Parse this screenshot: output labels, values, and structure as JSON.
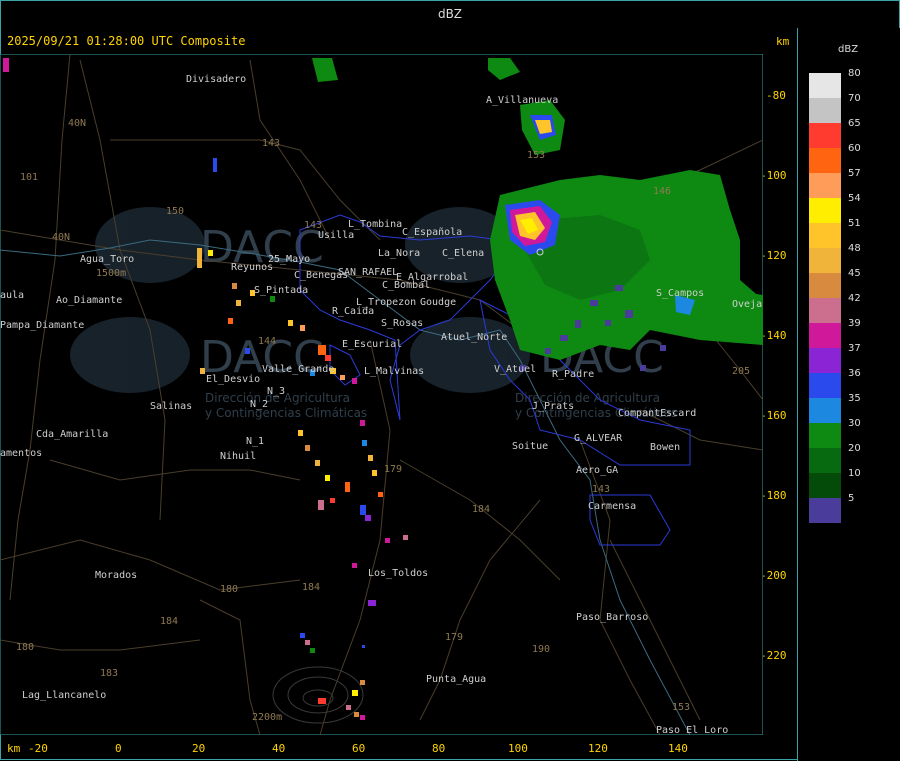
{
  "top_title": "dBZ",
  "header": {
    "timestamp": "2025/09/21 01:28:00 UTC Composite",
    "units_top": "km",
    "units_bottom": "km"
  },
  "x_axis": {
    "ticks": [
      "-20",
      "0",
      "20",
      "40",
      "60",
      "80",
      "100",
      "120",
      "140"
    ]
  },
  "y_axis": {
    "ticks": [
      "-80",
      "-100",
      "-120",
      "-140",
      "-160",
      "-180",
      "-200",
      "-220"
    ]
  },
  "legend": {
    "title": "dBZ",
    "entries": [
      {
        "label": "80",
        "color": "#e6e6e6"
      },
      {
        "label": "70",
        "color": "#c4c4c4"
      },
      {
        "label": "65",
        "color": "#ff3a2e"
      },
      {
        "label": "60",
        "color": "#ff6410"
      },
      {
        "label": "57",
        "color": "#ff9c5a"
      },
      {
        "label": "54",
        "color": "#ffee00"
      },
      {
        "label": "51",
        "color": "#ffc42a"
      },
      {
        "label": "48",
        "color": "#f0b43a"
      },
      {
        "label": "45",
        "color": "#d88a3e"
      },
      {
        "label": "42",
        "color": "#cc6e8e"
      },
      {
        "label": "39",
        "color": "#d0189a"
      },
      {
        "label": "37",
        "color": "#8a24d4"
      },
      {
        "label": "36",
        "color": "#2a4aee"
      },
      {
        "label": "35",
        "color": "#1c88e0"
      },
      {
        "label": "30",
        "color": "#0e8a12"
      },
      {
        "label": "20",
        "color": "#086a10"
      },
      {
        "label": "10",
        "color": "#044a08"
      },
      {
        "label": "5",
        "color": "#4a3c9a"
      }
    ]
  },
  "watermark": {
    "brand": "DACC",
    "line1": "Dirección de Agricultura",
    "line2": "y Contingencias Climáticas"
  },
  "places": [
    {
      "id": "divisadero",
      "name": "Divisadero"
    },
    {
      "id": "a-villanueva",
      "name": "A_Villanueva"
    },
    {
      "id": "agua-toro",
      "name": "Agua_Toro"
    },
    {
      "id": "reyunos",
      "name": "Reyunos"
    },
    {
      "id": "25-mayo",
      "name": "25_Mayo"
    },
    {
      "id": "s-pintada",
      "name": "S_Pintada"
    },
    {
      "id": "usilla",
      "name": "Usilla"
    },
    {
      "id": "l-tombina",
      "name": "L_Tombina"
    },
    {
      "id": "c-espanola",
      "name": "C_Española"
    },
    {
      "id": "la-nora",
      "name": "La_Nora"
    },
    {
      "id": "c-benegas",
      "name": "C_Benegas"
    },
    {
      "id": "san-rafael",
      "name": "SAN_RAFAEL"
    },
    {
      "id": "e-algarrobal",
      "name": "E_Algarrobal"
    },
    {
      "id": "c-bombal",
      "name": "C_Bombal"
    },
    {
      "id": "c-elena",
      "name": "C_Elena"
    },
    {
      "id": "tropezon",
      "name": "L_Tropezon"
    },
    {
      "id": "gouge",
      "name": "Goudge"
    },
    {
      "id": "r-caida",
      "name": "R_Caida"
    },
    {
      "id": "s-rosas",
      "name": "S_Rosas"
    },
    {
      "id": "atuel-norte",
      "name": "Atuel_Norte"
    },
    {
      "id": "e-escurial",
      "name": "E_Escurial"
    },
    {
      "id": "valle-grande",
      "name": "Valle_Grande"
    },
    {
      "id": "l-malvinas",
      "name": "L_Malvinas"
    },
    {
      "id": "el-desvio",
      "name": "El_Desvio"
    },
    {
      "id": "n3",
      "name": "N_3"
    },
    {
      "id": "n2",
      "name": "N_2"
    },
    {
      "id": "salinas",
      "name": "Salinas"
    },
    {
      "id": "n1",
      "name": "N_1"
    },
    {
      "id": "nihuil",
      "name": "Nihuil"
    },
    {
      "id": "v-atuel",
      "name": "V_Atuel"
    },
    {
      "id": "r-padre",
      "name": "R_Padre"
    },
    {
      "id": "j-prats",
      "name": "J_Prats"
    },
    {
      "id": "compantescard",
      "name": "CompantEscard"
    },
    {
      "id": "g-alvear",
      "name": "G_ALVEAR"
    },
    {
      "id": "soitue",
      "name": "Soitue"
    },
    {
      "id": "bowen",
      "name": "Bowen"
    },
    {
      "id": "aero-ga",
      "name": "Aero_GA"
    },
    {
      "id": "carmensa",
      "name": "Carmensa"
    },
    {
      "id": "s-campos",
      "name": "S_Campos"
    },
    {
      "id": "ovejas",
      "name": "Ovejas"
    },
    {
      "id": "pampa-diamante",
      "name": "Pampa_Diamante"
    },
    {
      "id": "ao-diamante",
      "name": "Ao_Diamante"
    },
    {
      "id": "cda-amarilla",
      "name": "Cda_Amarilla"
    },
    {
      "id": "amentos",
      "name": "amentos"
    },
    {
      "id": "aula",
      "name": "aula"
    },
    {
      "id": "morados",
      "name": "Morados"
    },
    {
      "id": "los-toldos",
      "name": "Los_Toldos"
    },
    {
      "id": "paso-barroso",
      "name": "Paso_Barroso"
    },
    {
      "id": "punta-agua",
      "name": "Punta_Agua"
    },
    {
      "id": "lag-llancanelo",
      "name": "Lag_Llancanelo"
    },
    {
      "id": "paso-el-loro",
      "name": "Paso_El_Loro"
    },
    {
      "id": "elev-1500",
      "name": "1500m"
    },
    {
      "id": "elev-2200",
      "name": "2200m"
    }
  ],
  "roads": [
    "40N",
    "101",
    "143",
    "153",
    "40N",
    "143",
    "144",
    "179",
    "184",
    "180",
    "184",
    "179",
    "190",
    "183",
    "184",
    "143",
    "153",
    "146",
    "205",
    "150",
    "180"
  ]
}
